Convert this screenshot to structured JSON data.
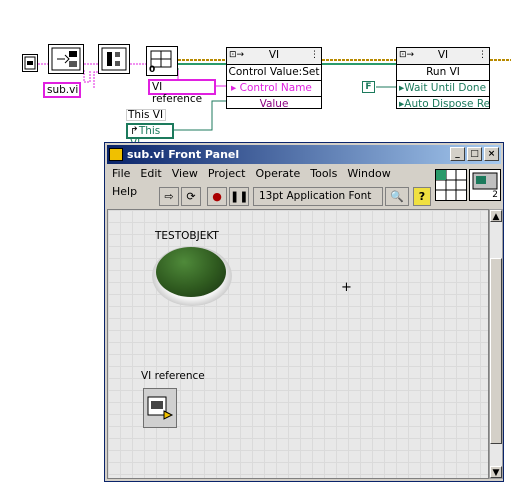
{
  "diagram": {
    "sub_vi_label": "sub.vi",
    "vi_reference_label": "VI reference",
    "this_vi_header": "This VI",
    "this_vi_label": "This VI",
    "constant_zero": "0",
    "false_constant": "F",
    "node1": {
      "title": "VI",
      "method": "Control Value:Set",
      "params": [
        "Control Name",
        "Value"
      ]
    },
    "node2": {
      "title": "VI",
      "method": "Run VI",
      "params": [
        "Wait Until Done",
        "Auto Dispose Ref"
      ]
    }
  },
  "window": {
    "title": "sub.vi Front Panel",
    "menu": [
      "File",
      "Edit",
      "View",
      "Project",
      "Operate",
      "Tools",
      "Window",
      "Help"
    ],
    "font_selector": "13pt Application Font",
    "panel": {
      "led_label": "TESTOBJEKT",
      "ref_label": "VI reference"
    },
    "icon_pane_number": "2"
  },
  "colors": {
    "pink_wire": "#e020e0",
    "green_wire": "#1c7a5c",
    "ref_wire": "#2a9a6a",
    "yellow_wire": "#d0b000",
    "titlebar": "#0a246a",
    "led": "#2f5a1f"
  }
}
